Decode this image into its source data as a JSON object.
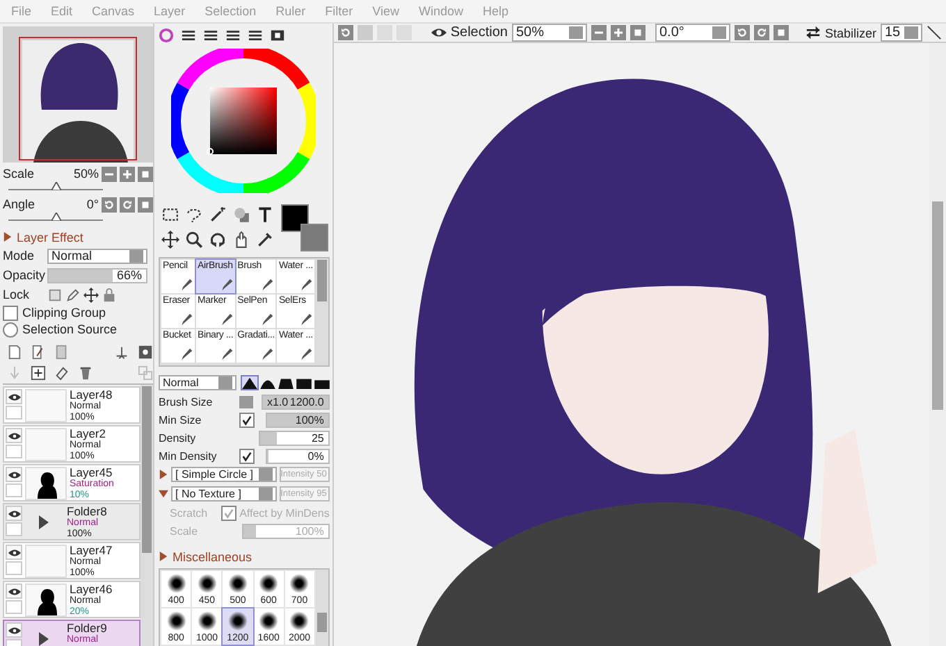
{
  "menu": [
    "File",
    "Edit",
    "Canvas",
    "Layer",
    "Selection",
    "Ruler",
    "Filter",
    "View",
    "Window",
    "Help"
  ],
  "navigator": {
    "scale": {
      "label": "Scale",
      "value": "50%",
      "level": 0.5
    },
    "angle": {
      "label": "Angle",
      "value": "0°",
      "level": 0.5
    }
  },
  "layer_panel": {
    "layer_effect": {
      "label": "Layer Effect",
      "expanded": false
    },
    "mode": {
      "label": "Mode",
      "value": "Normal"
    },
    "opacity": {
      "label": "Opacity",
      "value": "66%",
      "level": 0.66
    },
    "lock": {
      "label": "Lock"
    },
    "clipping_group": {
      "label": "Clipping Group",
      "checked": false
    },
    "selection_source": {
      "label": "Selection Source",
      "checked": false
    },
    "layers": [
      {
        "kind": "layer",
        "name": "Layer48",
        "filled_thumbnail": false,
        "blend": "Normal",
        "blend_highlight": false,
        "opacity": "100%",
        "opacity_highlight": false,
        "selected": false
      },
      {
        "kind": "layer",
        "name": "Layer2",
        "filled_thumbnail": false,
        "blend": "Normal",
        "blend_highlight": false,
        "opacity": "100%",
        "opacity_highlight": false,
        "selected": false
      },
      {
        "kind": "layer",
        "name": "Layer45",
        "filled_thumbnail": true,
        "blend": "Saturation",
        "blend_highlight": true,
        "opacity": "10%",
        "opacity_highlight": true,
        "selected": false
      },
      {
        "kind": "folder",
        "name": "Folder8",
        "blend": "Normal",
        "blend_highlight": true,
        "opacity": "100%",
        "opacity_highlight": false,
        "selected": false
      },
      {
        "kind": "layer",
        "name": "Layer47",
        "filled_thumbnail": false,
        "blend": "Normal",
        "blend_highlight": false,
        "opacity": "100%",
        "opacity_highlight": false,
        "selected": false
      },
      {
        "kind": "layer",
        "name": "Layer46",
        "filled_thumbnail": true,
        "blend": "Normal",
        "blend_highlight": false,
        "opacity": "20%",
        "opacity_highlight": true,
        "selected": false
      },
      {
        "kind": "folder",
        "name": "Folder9",
        "blend": "Normal",
        "blend_highlight": true,
        "selected": true
      }
    ]
  },
  "color_panel": {
    "swatches": [
      {
        "kind": "foreground",
        "color": "#000000"
      },
      {
        "kind": "background",
        "color": "#7a7a7a"
      }
    ]
  },
  "brushes": [
    {
      "name": "Pencil",
      "selected": false
    },
    {
      "name": "AirBrush",
      "selected": true
    },
    {
      "name": "Brush",
      "selected": false
    },
    {
      "name": "Water ...",
      "selected": false
    },
    {
      "name": "Eraser",
      "selected": false
    },
    {
      "name": "Marker",
      "selected": false
    },
    {
      "name": "SelPen",
      "selected": false
    },
    {
      "name": "SelErs",
      "selected": false
    },
    {
      "name": "Bucket",
      "selected": false
    },
    {
      "name": "Binary ...",
      "selected": false
    },
    {
      "name": "Gradati...",
      "selected": false
    },
    {
      "name": "Water ...",
      "selected": false
    }
  ],
  "brush_settings": {
    "blend": "Normal",
    "edges": [
      {
        "selected": true
      },
      {
        "selected": false
      },
      {
        "selected": false
      },
      {
        "selected": false
      },
      {
        "selected": false
      }
    ],
    "brush_size": {
      "label": "Brush Size",
      "multiplier": "x1.0",
      "value": "1200.0",
      "level": 1
    },
    "min_size": {
      "label": "Min Size",
      "checked": true,
      "value": "100%",
      "level": 1
    },
    "density": {
      "label": "Density",
      "value": "25",
      "level": 0.25
    },
    "min_density": {
      "label": "Min Density",
      "checked": true,
      "value": "0%",
      "level": 0
    },
    "shape": {
      "value": "[ Simple Circle ]",
      "expanded": false,
      "intensity": "Intensity 50",
      "disabled": true
    },
    "texture": {
      "value": "[ No Texture ]",
      "expanded": true,
      "intensity": "Intensity 95",
      "disabled": true
    },
    "scratch": {
      "label": "Scratch",
      "disabled": true
    },
    "affect": {
      "label": "Affect by MinDens",
      "checked": true,
      "disabled": true
    },
    "scale": {
      "label": "Scale",
      "value": "100%",
      "level": 0.15,
      "disabled": true
    },
    "misc": {
      "label": "Miscellaneous",
      "expanded": false
    },
    "tips": [
      {
        "size": "400",
        "selected": false
      },
      {
        "size": "450",
        "selected": false
      },
      {
        "size": "500",
        "selected": false
      },
      {
        "size": "600",
        "selected": false
      },
      {
        "size": "700",
        "selected": false
      },
      {
        "size": "800",
        "selected": false
      },
      {
        "size": "1000",
        "selected": false
      },
      {
        "size": "1200",
        "selected": true
      },
      {
        "size": "1600",
        "selected": false
      },
      {
        "size": "2000",
        "selected": false
      }
    ]
  },
  "canvas_toolbar": {
    "selection": "Selection",
    "zoom": "50%",
    "angle": "0.0°",
    "stabilizer_label": "Stabilizer",
    "stabilizer": "15"
  }
}
